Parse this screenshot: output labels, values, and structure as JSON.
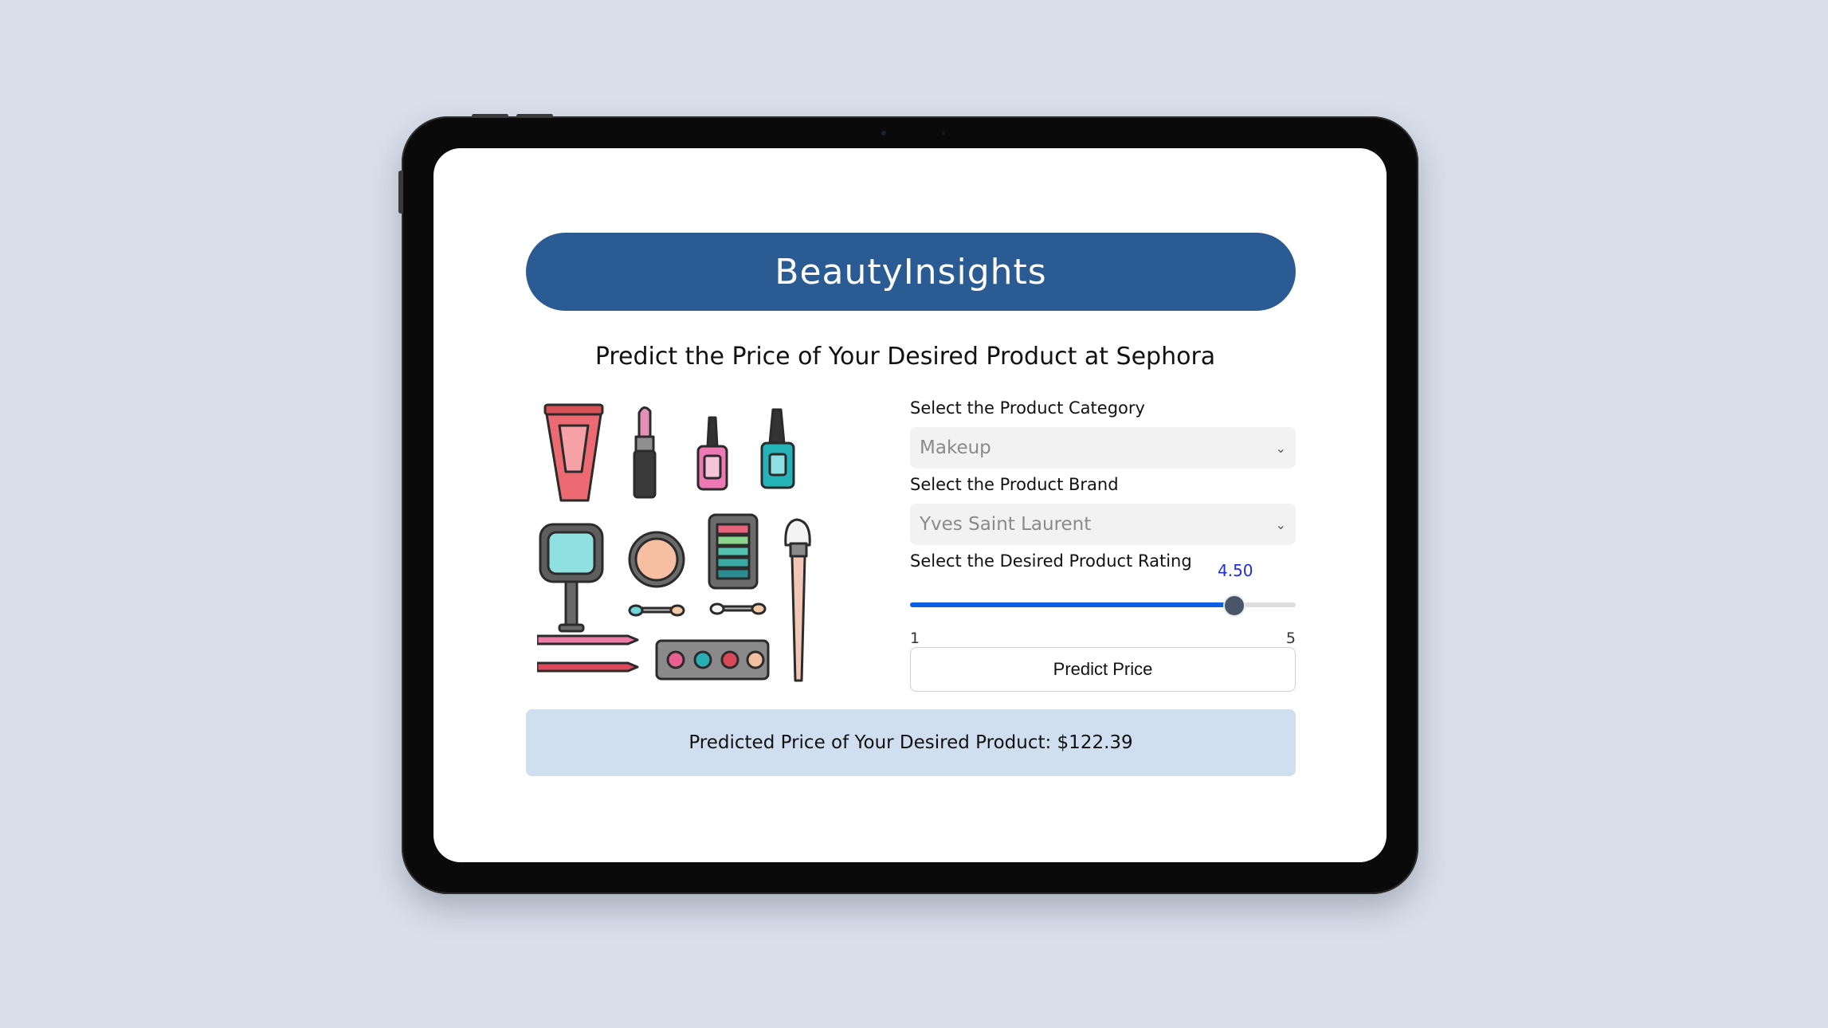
{
  "app": {
    "title": "BeautyInsights"
  },
  "subtitle": "Predict the Price of Your Desired Product at Sephora",
  "form": {
    "category_label": "Select the Product Category",
    "category_value": "Makeup",
    "brand_label": "Select the Product Brand",
    "brand_value": "Yves Saint Laurent",
    "rating_label": "Select the Desired Product Rating",
    "rating_value": "4.50",
    "rating_fraction": 0.875,
    "rating_min": "1",
    "rating_max": "5",
    "predict_button": "Predict Price"
  },
  "result": {
    "text": "Predicted Price of Your Desired Product: $122.39"
  },
  "illustration": {
    "icon": "makeup-products-illustration"
  },
  "colors": {
    "page_bg": "#d9dfea",
    "header_bg": "#2a5c93",
    "result_bg": "#cfdff0",
    "slider_fill": "#0d5ee0",
    "slider_value": "#1f2fe0"
  }
}
